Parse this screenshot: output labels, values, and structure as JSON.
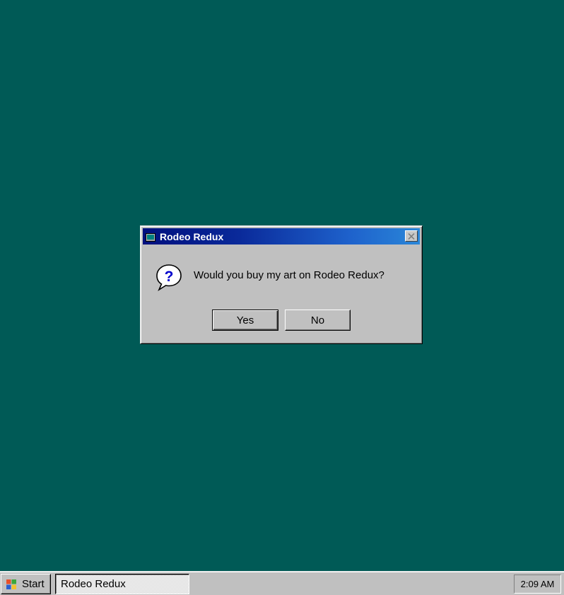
{
  "desktop": {
    "background_color": "#005a56"
  },
  "dialog": {
    "title": "Rodeo Redux",
    "title_icon": "app-window-icon",
    "close_icon": "close-icon",
    "message": "Would you buy my art on Rodeo Redux?",
    "message_icon": "question-icon",
    "buttons": {
      "yes": "Yes",
      "no": "No"
    },
    "titlebar_colors": [
      "#000f7e",
      "#2a86d8"
    ]
  },
  "taskbar": {
    "start_label": "Start",
    "start_icon": "windows-logo-icon",
    "tasks": [
      {
        "label": "Rodeo Redux",
        "active": true
      }
    ],
    "clock": "2:09 AM"
  }
}
